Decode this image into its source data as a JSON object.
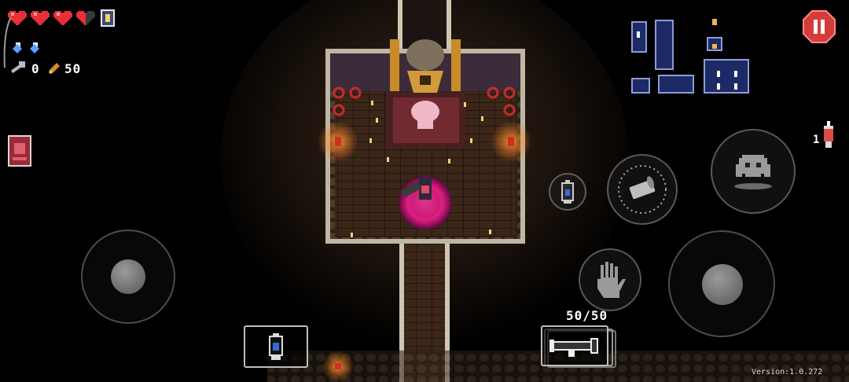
{
  "hud": {
    "hearts_full": 3,
    "hearts_half": 1,
    "blanks": 2,
    "keys": "0",
    "shells": "50"
  },
  "weapon": {
    "ammo": "50/50",
    "icon": "rocket-launcher-icon"
  },
  "active_item": {
    "icon": "lantern-icon"
  },
  "consumable": {
    "count": "1",
    "icon": "lighter-icon"
  },
  "buttons": {
    "interact_icon": "hand-icon",
    "dodge_icon": "ghost-icon",
    "reload_icon": "bullet-spin-icon",
    "pause_icon": "pause-icon"
  },
  "version": "Version:1.0.272",
  "colors": {
    "heart": "#e8303a",
    "blank": "#5aa0ff",
    "pause_bg": "#d63b3b",
    "map_room": "#1e2a66",
    "map_border": "#8d9bd6",
    "magic_circle": "#e0248c"
  }
}
